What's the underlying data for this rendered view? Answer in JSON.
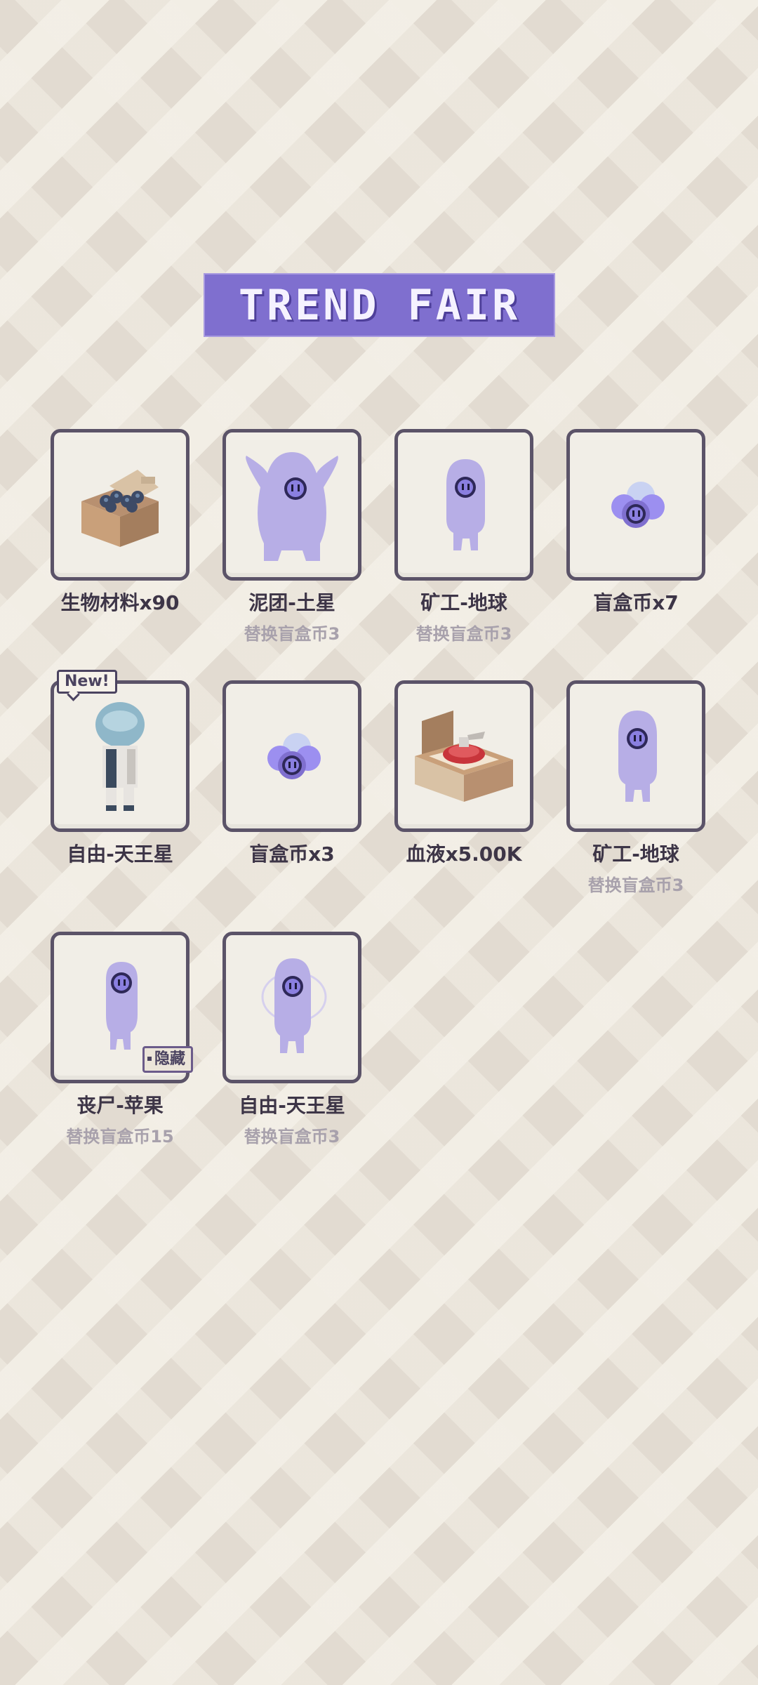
{
  "header": {
    "title": "TREND FAIR"
  },
  "items": [
    {
      "name": "生物材料x90",
      "sub": "",
      "icon": "material-box-icon"
    },
    {
      "name": "泥团-土星",
      "sub": "替换盲盒币3",
      "icon": "ghost-silhouette-icon"
    },
    {
      "name": "矿工-地球",
      "sub": "替换盲盒币3",
      "icon": "ghost-silhouette-icon"
    },
    {
      "name": "盲盒币x7",
      "sub": "",
      "icon": "blindbox-coin-icon"
    },
    {
      "name": "自由-天王星",
      "sub": "",
      "icon": "astronaut-character-icon",
      "badge": "New!"
    },
    {
      "name": "盲盒币x3",
      "sub": "",
      "icon": "blindbox-coin-icon"
    },
    {
      "name": "血液x5.00K",
      "sub": "",
      "icon": "blood-box-icon"
    },
    {
      "name": "矿工-地球",
      "sub": "替换盲盒币3",
      "icon": "ghost-silhouette-icon"
    },
    {
      "name": "丧尸-苹果",
      "sub": "替换盲盒币15",
      "icon": "ghost-silhouette-icon",
      "tag": "隐藏"
    },
    {
      "name": "自由-天王星",
      "sub": "替换盲盒币3",
      "icon": "ghost-silhouette-icon"
    }
  ],
  "colors": {
    "accent": "#7f6fcf",
    "silhouette": "#b7aee6",
    "card_border": "#5b5368",
    "text_dark": "#3d3547",
    "text_muted": "#a8a1ac"
  }
}
